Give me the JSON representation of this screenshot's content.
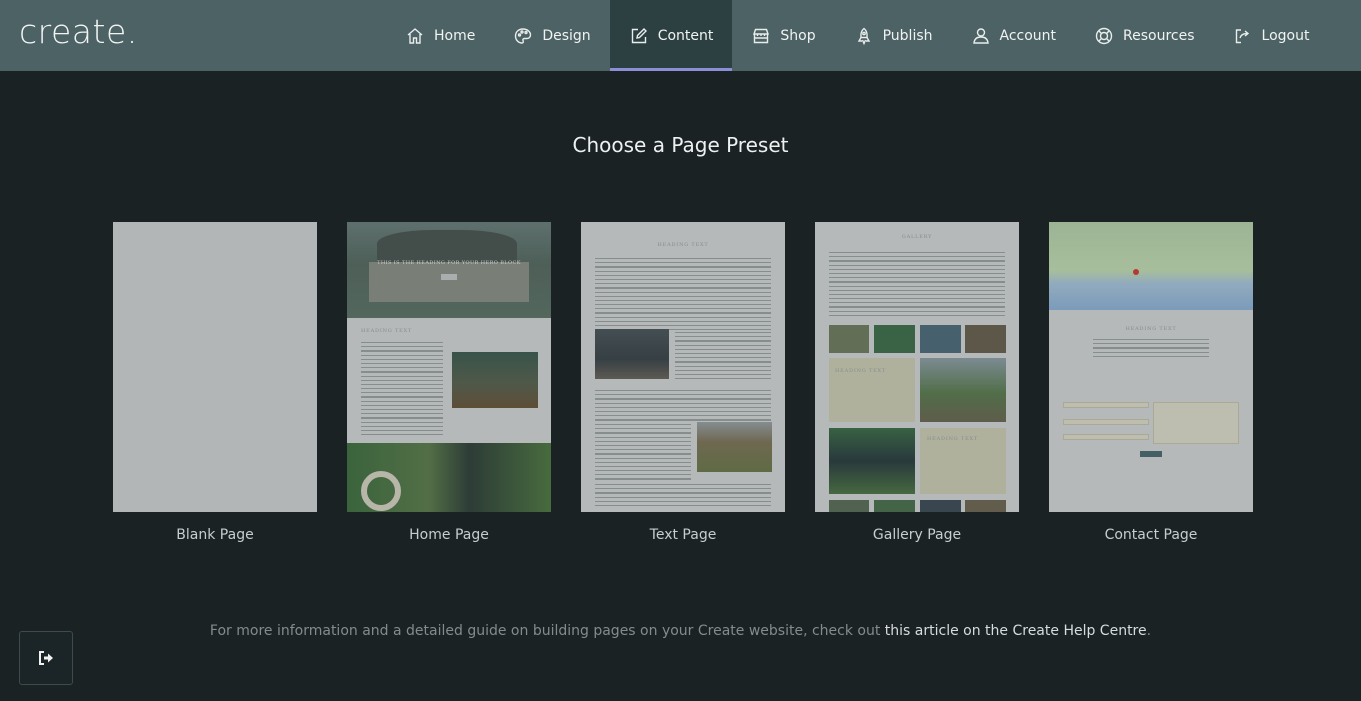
{
  "brand": {
    "logo_text": "create",
    "logo_dot": "."
  },
  "nav": {
    "items": [
      {
        "label": "Home",
        "icon": "home-icon"
      },
      {
        "label": "Design",
        "icon": "palette-icon"
      },
      {
        "label": "Content",
        "icon": "edit-icon",
        "active": true
      },
      {
        "label": "Shop",
        "icon": "shop-icon"
      },
      {
        "label": "Publish",
        "icon": "rocket-icon"
      },
      {
        "label": "Account",
        "icon": "user-icon"
      },
      {
        "label": "Resources",
        "icon": "lifebuoy-icon"
      },
      {
        "label": "Logout",
        "icon": "logout-icon"
      }
    ]
  },
  "main": {
    "heading": "Choose a Page Preset",
    "presets": [
      {
        "label": "Blank Page"
      },
      {
        "label": "Home Page",
        "hero_heading": "THIS IS THE HEADING FOR YOUR HERO BLOCK",
        "section_heading": "HEADING TEXT"
      },
      {
        "label": "Text Page",
        "section_heading": "HEADING TEXT"
      },
      {
        "label": "Gallery Page",
        "section_heading": "GALLERY",
        "sub_heading_1": "HEADING TEXT",
        "sub_heading_2": "HEADING TEXT"
      },
      {
        "label": "Contact Page",
        "section_heading": "HEADING TEXT"
      }
    ]
  },
  "footer": {
    "text_before": "For more information and a detailed guide on building pages on your Create website, check out ",
    "link_text": "this article on the Create Help Centre",
    "text_after": "."
  },
  "colors": {
    "background": "#1a2224",
    "topbar": "#4c6264",
    "active_tab": "#2c4042",
    "active_indicator": "#8b8fd6"
  }
}
